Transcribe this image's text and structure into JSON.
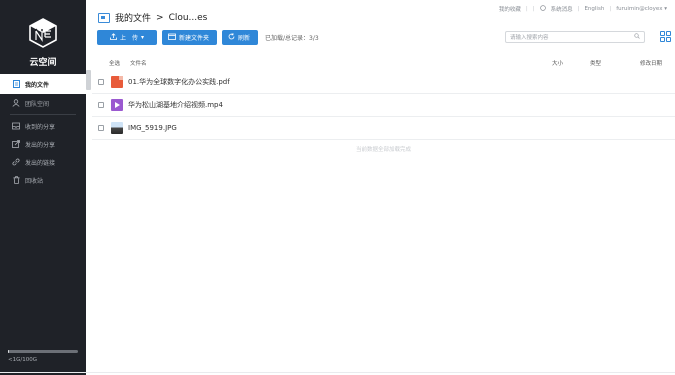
{
  "app": {
    "name": "云空间"
  },
  "sidebar": {
    "items": [
      {
        "label": "我的文件",
        "icon": "document-icon",
        "active": true
      },
      {
        "label": "团队空间",
        "icon": "team-icon",
        "active": false
      },
      {
        "label": "收到的分享",
        "icon": "inbox-icon",
        "active": false
      },
      {
        "label": "发出的分享",
        "icon": "share-out-icon",
        "active": false
      },
      {
        "label": "发出的链接",
        "icon": "link-icon",
        "active": false
      },
      {
        "label": "回收站",
        "icon": "trash-icon",
        "active": false
      }
    ],
    "quota_text": "<1G/100G",
    "quota_fraction": 0.01
  },
  "topbar": {
    "favorites": "我的收藏",
    "messages": "系统消息",
    "language": "English",
    "user": "furuimin@cloyex"
  },
  "breadcrumb": {
    "root": "我的文件",
    "separator": ">",
    "current": "Clou...es"
  },
  "toolbar": {
    "upload_label": "上　传",
    "new_folder_label": "新建文件夹",
    "refresh_label": "刷新",
    "loaded_label": "已加载/总记录：",
    "loaded_value": "3/3"
  },
  "search": {
    "placeholder": "请输入搜索内容"
  },
  "list": {
    "headers": {
      "select_all": "全选",
      "name": "文件名",
      "size": "大小",
      "type": "类型",
      "modified": "修改日期"
    },
    "rows": [
      {
        "name": "01.华为全球数字化办公实践.pdf",
        "icon": "pdf-icon"
      },
      {
        "name": "华为松山湖基地介绍视频.mp4",
        "icon": "video-icon"
      },
      {
        "name": "IMG_5919.JPG",
        "icon": "image-icon"
      }
    ],
    "empty_note": "当前数据全部加载完成"
  },
  "colors": {
    "sidebar_bg": "#1f2228",
    "accent": "#2f87d8"
  }
}
